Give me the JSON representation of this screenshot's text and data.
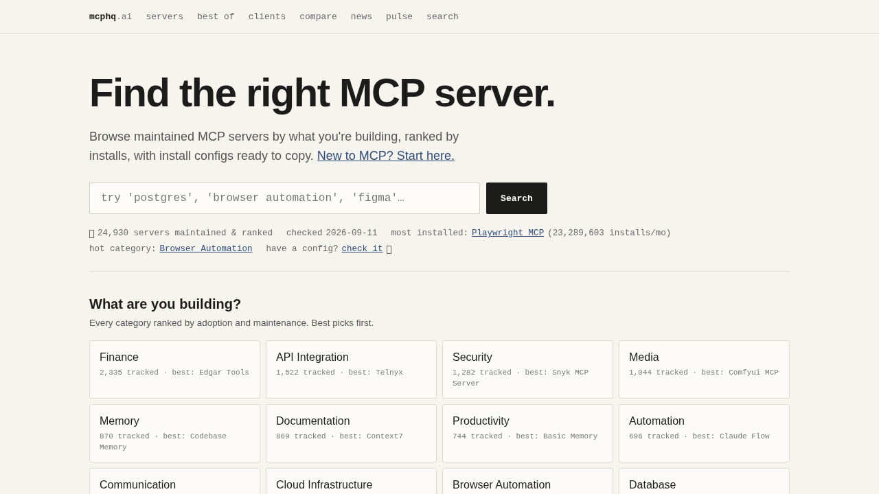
{
  "nav": {
    "logo_bold": "mcphq",
    "logo_rest": ".ai",
    "links": [
      "servers",
      "best of",
      "clients",
      "compare",
      "news",
      "pulse",
      "search"
    ]
  },
  "hero": {
    "title": "Find the right MCP server.",
    "subtitle": "Browse maintained MCP servers by what you're building, ranked by installs, with install configs ready to copy.",
    "subtitle_link": "New to MCP? Start here."
  },
  "search": {
    "placeholder": "try 'postgres', 'browser automation', 'figma'…",
    "button": "Search"
  },
  "stats": {
    "count": "24,930 servers maintained & ranked",
    "checked_label": "checked",
    "checked_date": "2026-09-11",
    "most_label": "most installed:",
    "most_link": "Playwright MCP",
    "most_installs": "(23,289,603 installs/mo)",
    "hot_label": "hot category:",
    "hot_link": "Browser Automation",
    "config_label": "have a config?",
    "config_link": "check it"
  },
  "section": {
    "title": "What are you building?",
    "subtitle": "Every category ranked by adoption and maintenance. Best picks first."
  },
  "categories": [
    {
      "name": "Finance",
      "meta": "2,335 tracked · best: Edgar Tools"
    },
    {
      "name": "API Integration",
      "meta": "1,522 tracked · best: Telnyx"
    },
    {
      "name": "Security",
      "meta": "1,282 tracked · best: Snyk MCP Server"
    },
    {
      "name": "Media",
      "meta": "1,044 tracked · best: Comfyui MCP"
    },
    {
      "name": "Memory",
      "meta": "870 tracked · best: Codebase Memory"
    },
    {
      "name": "Documentation",
      "meta": "869 tracked · best: Context7"
    },
    {
      "name": "Productivity",
      "meta": "744 tracked · best: Basic Memory"
    },
    {
      "name": "Automation",
      "meta": "696 tracked · best: Claude Flow"
    },
    {
      "name": "Communication"
    },
    {
      "name": "Cloud Infrastructure"
    },
    {
      "name": "Browser Automation"
    },
    {
      "name": "Database"
    }
  ]
}
